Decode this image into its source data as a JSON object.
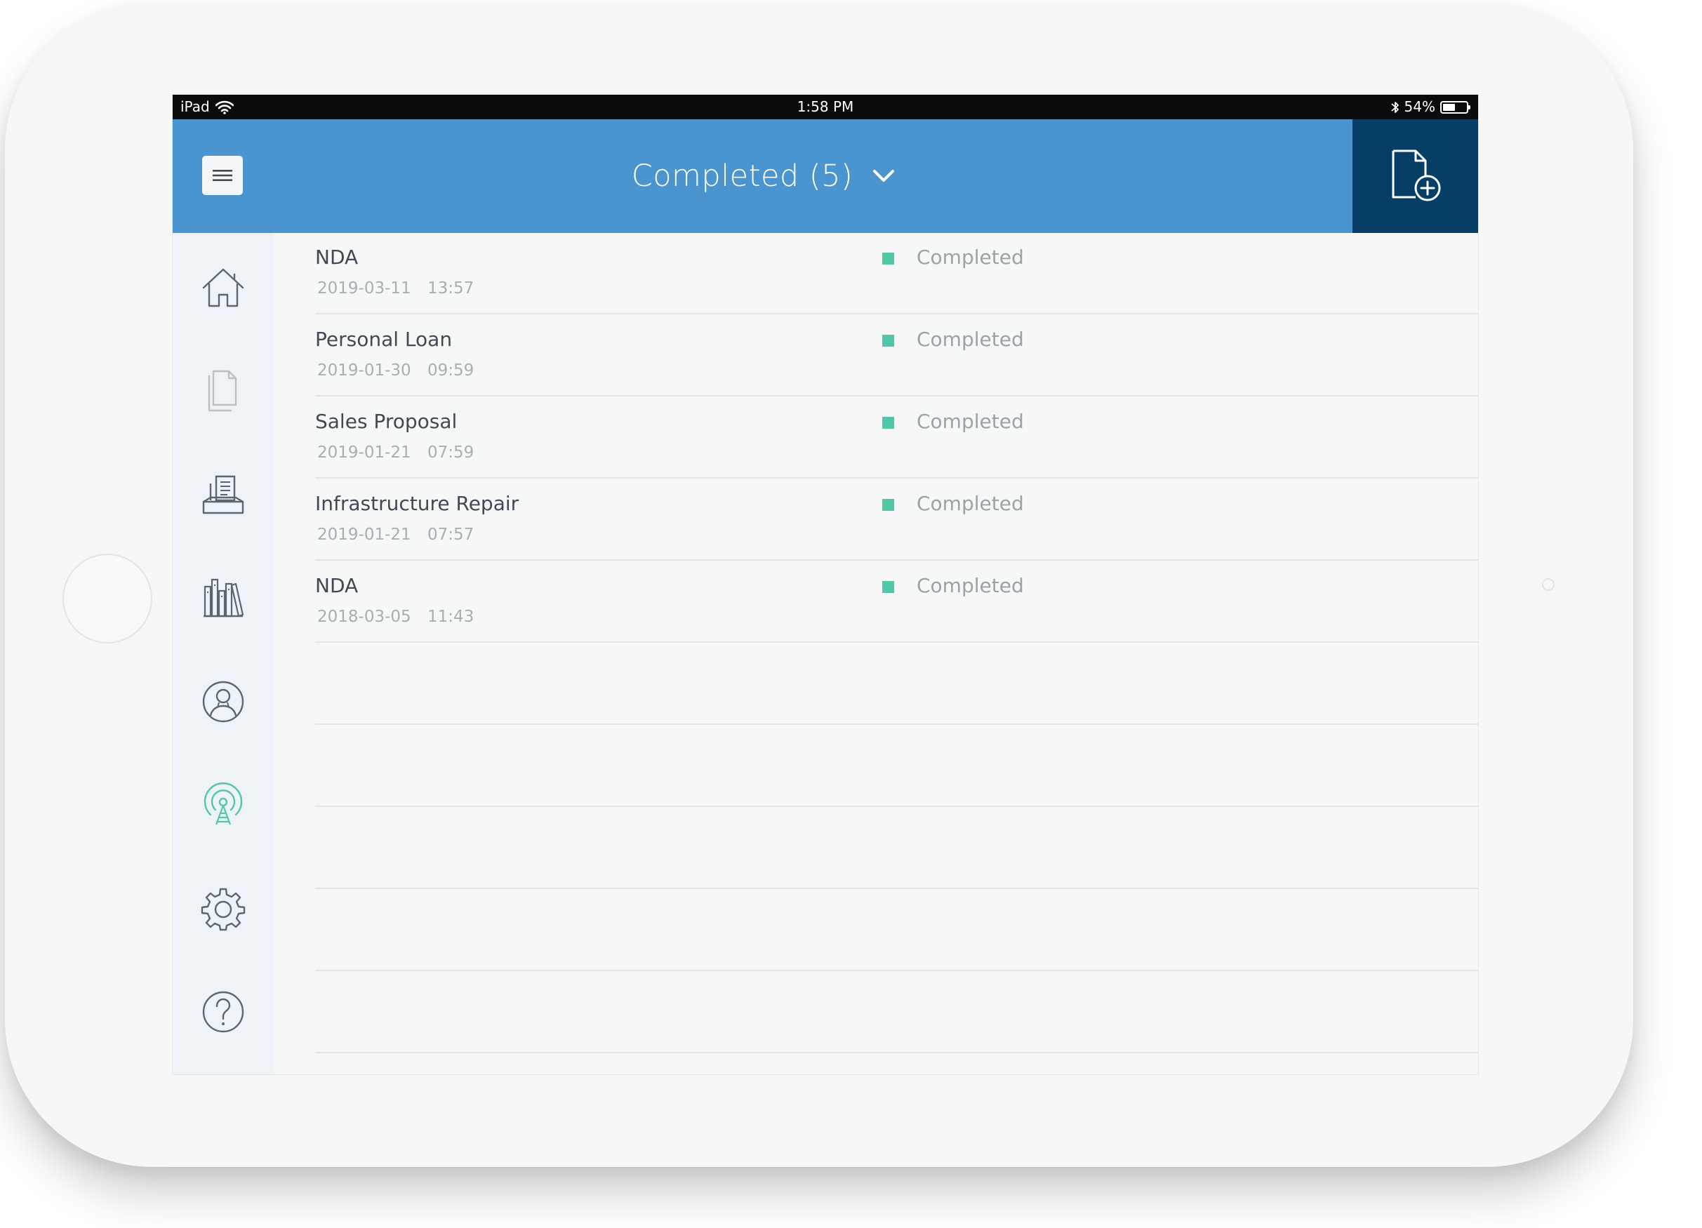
{
  "statusbar": {
    "device": "iPad",
    "time": "1:58 PM",
    "battery": "54%",
    "battery_level": 0.54
  },
  "header": {
    "title": "Completed (5)"
  },
  "icons": {
    "menu": "menu-icon",
    "dropdown": "chevron-down-icon",
    "new_document": "new-document-icon",
    "wifi": "wifi-icon",
    "bluetooth": "bluetooth-icon",
    "battery": "battery-icon"
  },
  "sidebar": {
    "items": [
      {
        "icon": "home-icon",
        "active": false
      },
      {
        "icon": "documents-icon",
        "active": false
      },
      {
        "icon": "inbox-icon",
        "active": false
      },
      {
        "icon": "library-icon",
        "active": false
      },
      {
        "icon": "user-icon",
        "active": false
      },
      {
        "icon": "broadcast-icon",
        "active": true
      },
      {
        "icon": "settings-icon",
        "active": false
      },
      {
        "icon": "help-icon",
        "active": false
      }
    ]
  },
  "documents": [
    {
      "name": "NDA",
      "date": "2019-03-11",
      "time": "13:57",
      "status": "Completed"
    },
    {
      "name": "Personal Loan",
      "date": "2019-01-30",
      "time": "09:59",
      "status": "Completed"
    },
    {
      "name": "Sales Proposal",
      "date": "2019-01-21",
      "time": "07:59",
      "status": "Completed"
    },
    {
      "name": "Infrastructure Repair",
      "date": "2019-01-21",
      "time": "07:57",
      "status": "Completed"
    },
    {
      "name": "NDA",
      "date": "2018-03-05",
      "time": "11:43",
      "status": "Completed"
    }
  ],
  "colors": {
    "header": "#4a95cf",
    "header_action": "#063e66",
    "status_completed": "#52c7a8",
    "active_nav": "#52c7a8"
  }
}
